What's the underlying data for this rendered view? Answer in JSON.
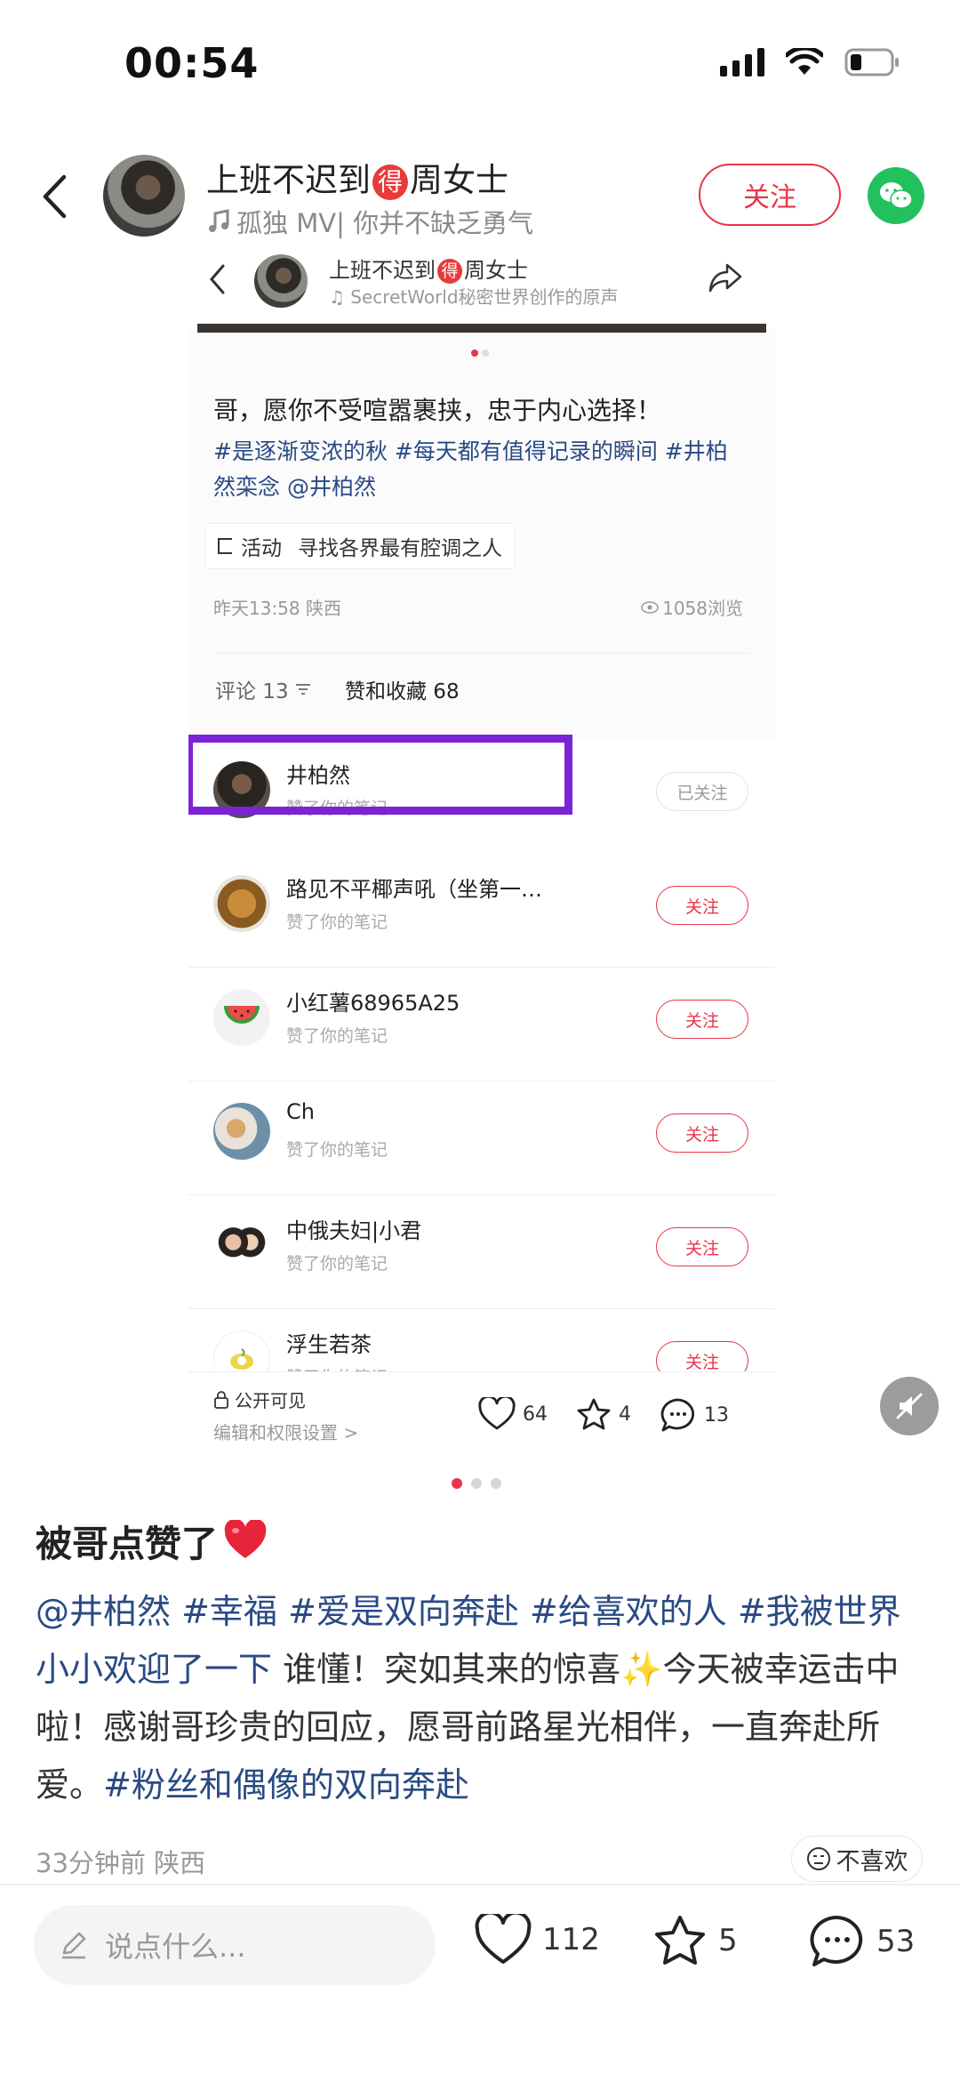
{
  "status_bar": {
    "time": "00:54"
  },
  "header": {
    "author_name_part1": "上班不迟到",
    "author_name_badge": "得",
    "author_name_part2": "周女士",
    "music": "孤独 MV| 你并不缺乏勇气",
    "follow_label": "关注"
  },
  "embedded": {
    "author_name_part1": "上班不迟到",
    "author_name_badge": "得",
    "author_name_part2": "周女士",
    "music": "SecretWorld秘密世界创作的原声",
    "title": "哥，愿你不受喧嚣裹挟，忠于内心选择！",
    "tags": "#是逐渐变浓的秋 #每天都有值得记录的瞬间 #井柏然栾念 @井柏然",
    "activity_label": "活动",
    "activity_text": "寻找各界最有腔调之人",
    "time_location": "昨天13:58 陕西",
    "views": "1058浏览",
    "tab_comments": "评论 13",
    "tab_likes": "赞和收藏 68",
    "likers": [
      {
        "name": "井柏然",
        "sub": "赞了你的笔记",
        "button": "已关注"
      },
      {
        "name": "路见不平椰声吼（坐第一…",
        "sub": "赞了你的笔记",
        "button": "关注"
      },
      {
        "name": "小红薯68965A25",
        "sub": "赞了你的笔记",
        "button": "关注"
      },
      {
        "name": "Ch",
        "sub": "赞了你的笔记",
        "button": "关注"
      },
      {
        "name": "中俄夫妇|小君",
        "sub": "赞了你的笔记",
        "button": "关注"
      },
      {
        "name": "浮生若茶",
        "sub": "赞了你的笔记",
        "button": "关注"
      }
    ],
    "visibility": "公开可见",
    "permission": "编辑和权限设置 >",
    "likes": "64",
    "collects": "4",
    "comments": "13"
  },
  "post": {
    "title": "被哥点赞了",
    "body_tag1": "@井柏然 #幸福 #爱是双向奔赴 #给喜欢的人 #我被世界小小欢迎了一下",
    "body_text1": " 谁懂！突如其来的惊喜",
    "body_text2": "今天被幸运击中啦！感谢哥珍贵的回应，愿哥前路星光相伴，一直奔赴所爱。",
    "body_tag2": "#粉丝和偶像的双向奔赴",
    "meta": "33分钟前 陕西",
    "dislike_label": "不喜欢"
  },
  "bottom_bar": {
    "comment_placeholder": "说点什么...",
    "likes": "112",
    "collects": "5",
    "comments": "53"
  },
  "colors": {
    "accent": "#e8344a",
    "tag": "#294a84",
    "highlight": "#7b24d6",
    "wechat": "#22c15e"
  }
}
